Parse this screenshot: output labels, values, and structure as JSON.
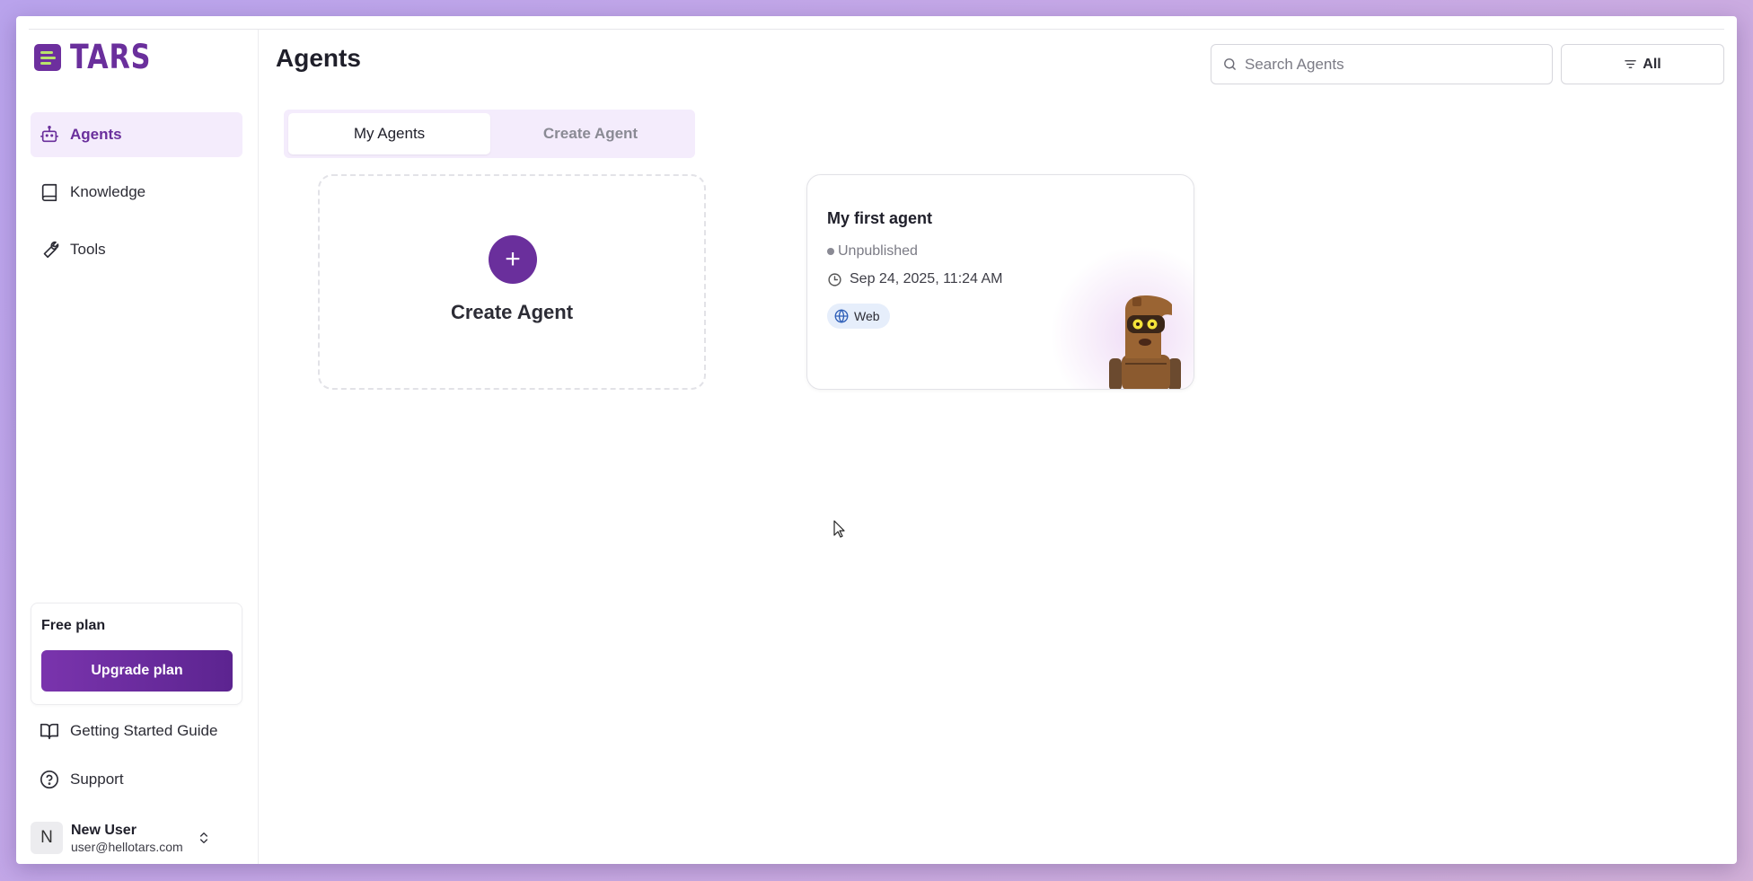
{
  "app": {
    "name": "TARS"
  },
  "sidebar": {
    "items": [
      {
        "label": "Agents",
        "icon": "robot-icon",
        "active": true
      },
      {
        "label": "Knowledge",
        "icon": "book-icon",
        "active": false
      },
      {
        "label": "Tools",
        "icon": "wrench-icon",
        "active": false
      }
    ],
    "plan": {
      "title": "Free plan",
      "upgrade_label": "Upgrade plan"
    },
    "links": [
      {
        "label": "Getting Started Guide",
        "icon": "open-book-icon"
      },
      {
        "label": "Support",
        "icon": "help-circle-icon"
      }
    ],
    "user": {
      "initial": "N",
      "name": "New User",
      "email": "user@hellotars.com"
    }
  },
  "header": {
    "title": "Agents",
    "search": {
      "placeholder": "Search Agents",
      "value": ""
    },
    "filter": {
      "label": "All"
    }
  },
  "tabs": [
    {
      "label": "My Agents",
      "active": true
    },
    {
      "label": "Create Agent",
      "active": false
    }
  ],
  "create_card": {
    "label": "Create Agent"
  },
  "agents": [
    {
      "name": "My first agent",
      "status": "Unpublished",
      "date": "Sep 24, 2025, 11:24 AM",
      "channel": "Web"
    }
  ],
  "colors": {
    "brand": "#6a2f9c",
    "brand_light": "#f4ecfc",
    "logo_accent": "#b9e36b",
    "badge_bg": "#e6eefb"
  }
}
